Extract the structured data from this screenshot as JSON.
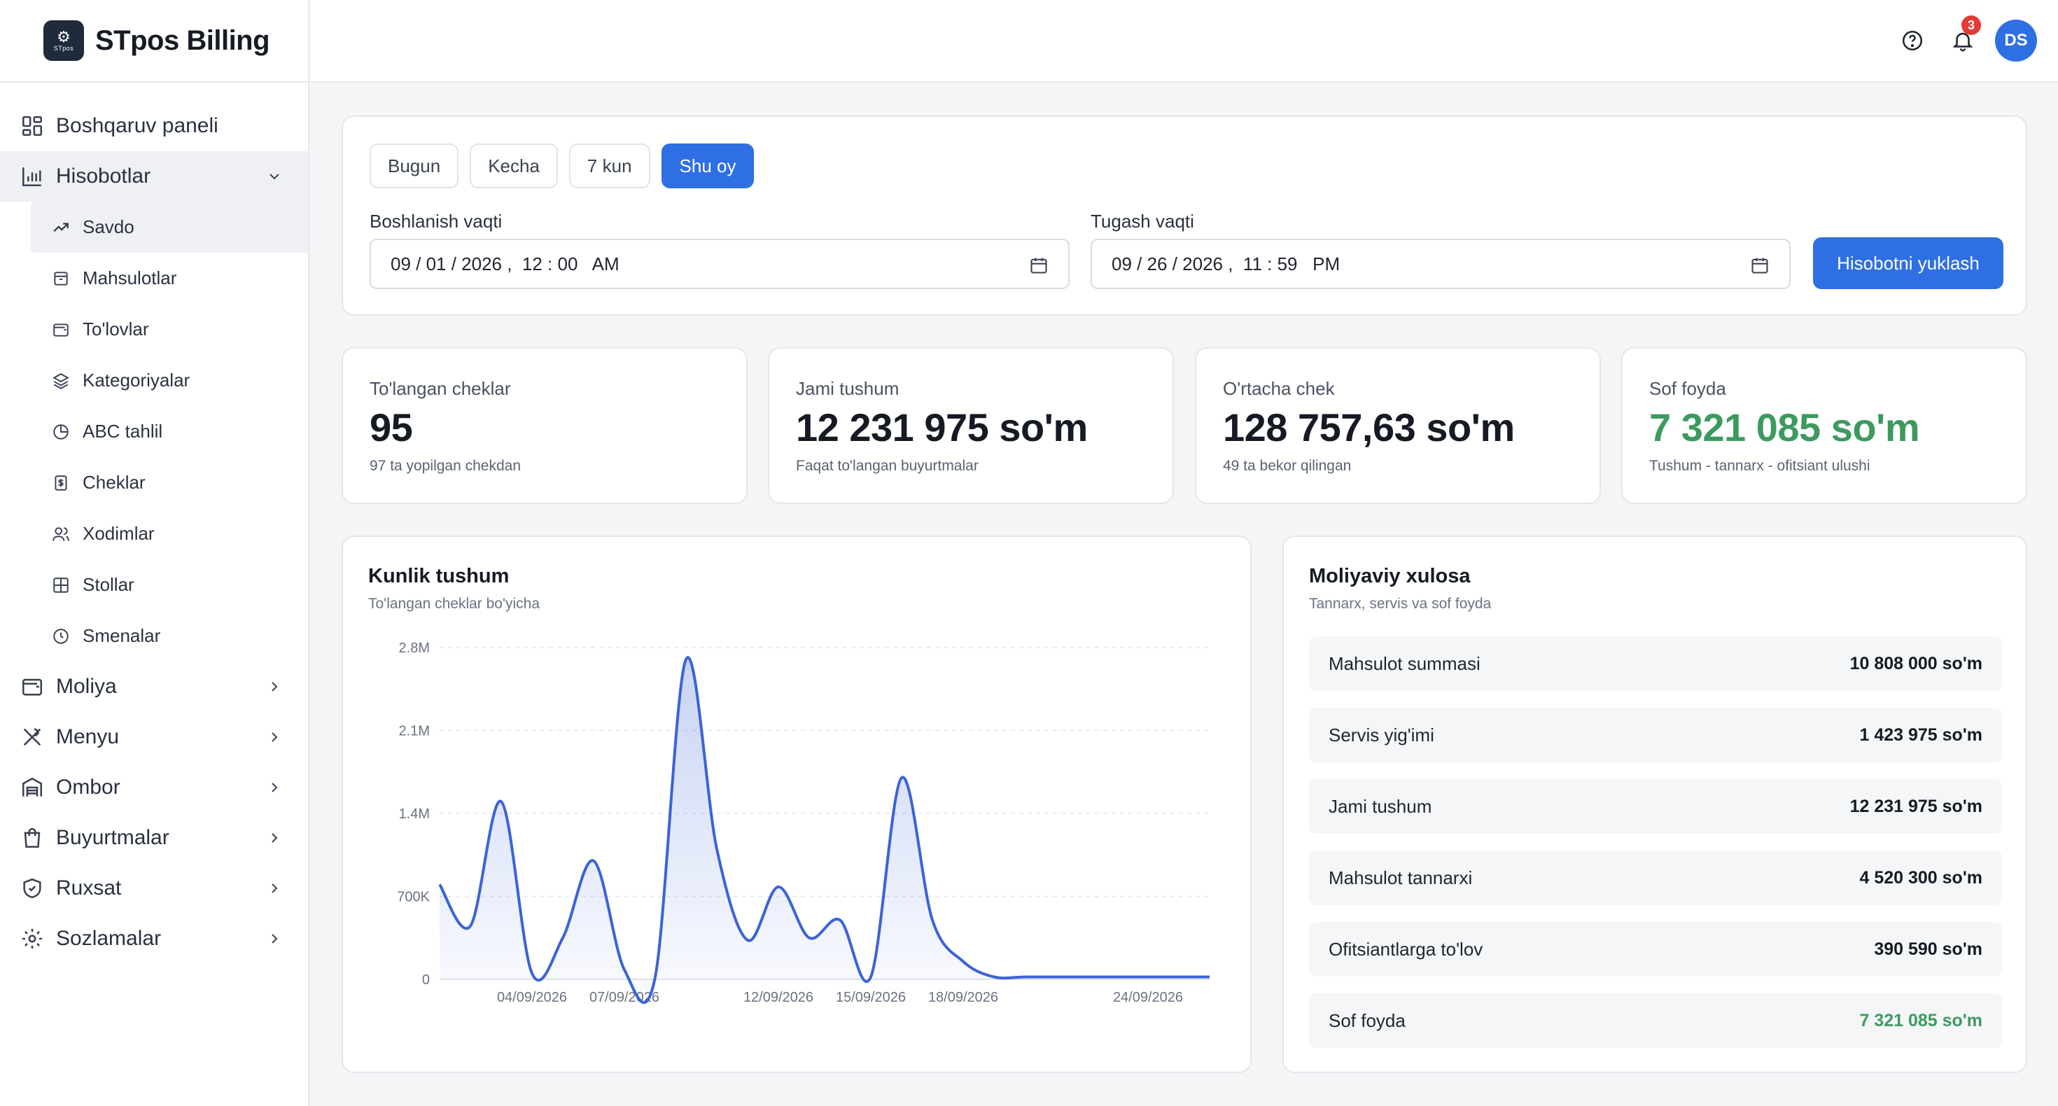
{
  "brand": {
    "name": "STpos Billing",
    "logo_text": "STpos"
  },
  "sidebar": {
    "items": [
      {
        "label": "Boshqaruv paneli",
        "icon": "dashboard-icon"
      },
      {
        "label": "Hisobotlar",
        "icon": "bar-chart-icon",
        "expanded": true
      },
      {
        "label": "Moliya",
        "icon": "wallet-icon"
      },
      {
        "label": "Menyu",
        "icon": "utensils-icon"
      },
      {
        "label": "Ombor",
        "icon": "warehouse-icon"
      },
      {
        "label": "Buyurtmalar",
        "icon": "shopping-bag-icon"
      },
      {
        "label": "Ruxsat",
        "icon": "shield-icon"
      },
      {
        "label": "Sozlamalar",
        "icon": "gear-icon"
      }
    ],
    "sub_items": [
      {
        "label": "Savdo",
        "icon": "trending-up-icon",
        "current": true
      },
      {
        "label": "Mahsulotlar",
        "icon": "package-icon"
      },
      {
        "label": "To'lovlar",
        "icon": "wallet-small-icon"
      },
      {
        "label": "Kategoriyalar",
        "icon": "layers-icon"
      },
      {
        "label": "ABC tahlil",
        "icon": "pie-chart-icon"
      },
      {
        "label": "Cheklar",
        "icon": "receipt-icon"
      },
      {
        "label": "Xodimlar",
        "icon": "users-icon"
      },
      {
        "label": "Stollar",
        "icon": "table-grid-icon"
      },
      {
        "label": "Smenalar",
        "icon": "clock-icon"
      }
    ]
  },
  "header": {
    "notifications_count": "3",
    "avatar_initials": "DS"
  },
  "filters": {
    "quick": [
      "Bugun",
      "Kecha",
      "7 kun",
      "Shu oy"
    ],
    "active_quick": "Shu oy",
    "start_label": "Boshlanish vaqti",
    "start_value": "09 / 01 / 2026 ,  12 : 00   AM",
    "end_label": "Tugash vaqti",
    "end_value": "09 / 26 / 2026 ,  11 : 59   PM",
    "load_button": "Hisobotni yuklash"
  },
  "stats": [
    {
      "label": "To'langan cheklar",
      "value": "95",
      "note": "97 ta yopilgan chekdan"
    },
    {
      "label": "Jami tushum",
      "value": "12 231 975 so'm",
      "note": "Faqat to'langan buyurtmalar"
    },
    {
      "label": "O'rtacha chek",
      "value": "128 757,63 so'm",
      "note": "49 ta bekor qilingan"
    },
    {
      "label": "Sof foyda",
      "value": "7 321 085 so'm",
      "note": "Tushum - tannarx - ofitsiant ulushi",
      "accent": "#3c9a5f"
    }
  ],
  "chart_card": {
    "title": "Kunlik tushum",
    "subtitle": "To'langan cheklar bo'yicha"
  },
  "chart_data": {
    "type": "area",
    "title": "Kunlik tushum",
    "subtitle": "To'langan cheklar bo'yicha",
    "xlabel": "",
    "ylabel": "",
    "x": [
      "01/09/2026",
      "02/09/2026",
      "03/09/2026",
      "04/09/2026",
      "05/09/2026",
      "06/09/2026",
      "07/09/2026",
      "08/09/2026",
      "09/09/2026",
      "10/09/2026",
      "11/09/2026",
      "12/09/2026",
      "13/09/2026",
      "14/09/2026",
      "15/09/2026",
      "16/09/2026",
      "17/09/2026",
      "18/09/2026",
      "19/09/2026",
      "20/09/2026",
      "21/09/2026",
      "22/09/2026",
      "23/09/2026",
      "24/09/2026",
      "25/09/2026",
      "26/09/2026"
    ],
    "values": [
      800000,
      450000,
      1500000,
      50000,
      350000,
      1000000,
      80000,
      20000,
      2700000,
      1100000,
      330000,
      780000,
      350000,
      500000,
      20000,
      1700000,
      500000,
      150000,
      20000,
      20000,
      20000,
      20000,
      20000,
      20000,
      20000,
      20000
    ],
    "x_tick_labels": [
      "04/09/2026",
      "07/09/2026",
      "12/09/2026",
      "15/09/2026",
      "18/09/2026",
      "24/09/2026"
    ],
    "y_tick_labels": [
      "0",
      "700K",
      "1.4M",
      "2.1M",
      "2.8M"
    ],
    "y_ticks": [
      0,
      700000,
      1400000,
      2100000,
      2800000
    ],
    "ylim": [
      0,
      2800000
    ],
    "grid": true,
    "color": "#3b63d8"
  },
  "finance": {
    "title": "Moliyaviy xulosa",
    "subtitle": "Tannarx, servis va sof foyda",
    "rows": [
      {
        "label": "Mahsulot summasi",
        "value": "10 808 000 so'm"
      },
      {
        "label": "Servis yig'imi",
        "value": "1 423 975 so'm"
      },
      {
        "label": "Jami tushum",
        "value": "12 231 975 so'm"
      },
      {
        "label": "Mahsulot tannarxi",
        "value": "4 520 300 so'm"
      },
      {
        "label": "Ofitsiantlarga to'lov",
        "value": "390 590 so'm"
      },
      {
        "label": "Sof foyda",
        "value": "7 321 085 so'm",
        "accent": "#3c9a5f"
      }
    ]
  }
}
